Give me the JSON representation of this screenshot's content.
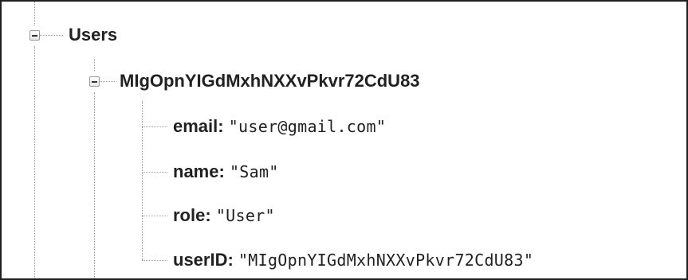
{
  "tree": {
    "root": {
      "label": "Users",
      "child": {
        "label": "MIgOpnYIGdMxhNXXvPkvr72CdU83",
        "fields": [
          {
            "key": "email",
            "value": "\"user@gmail.com\""
          },
          {
            "key": "name",
            "value": "\"Sam\""
          },
          {
            "key": "role",
            "value": "\"User\""
          },
          {
            "key": "userID",
            "value": "\"MIgOpnYIGdMxhNXXvPkvr72CdU83\""
          }
        ]
      }
    },
    "colon": ":"
  }
}
